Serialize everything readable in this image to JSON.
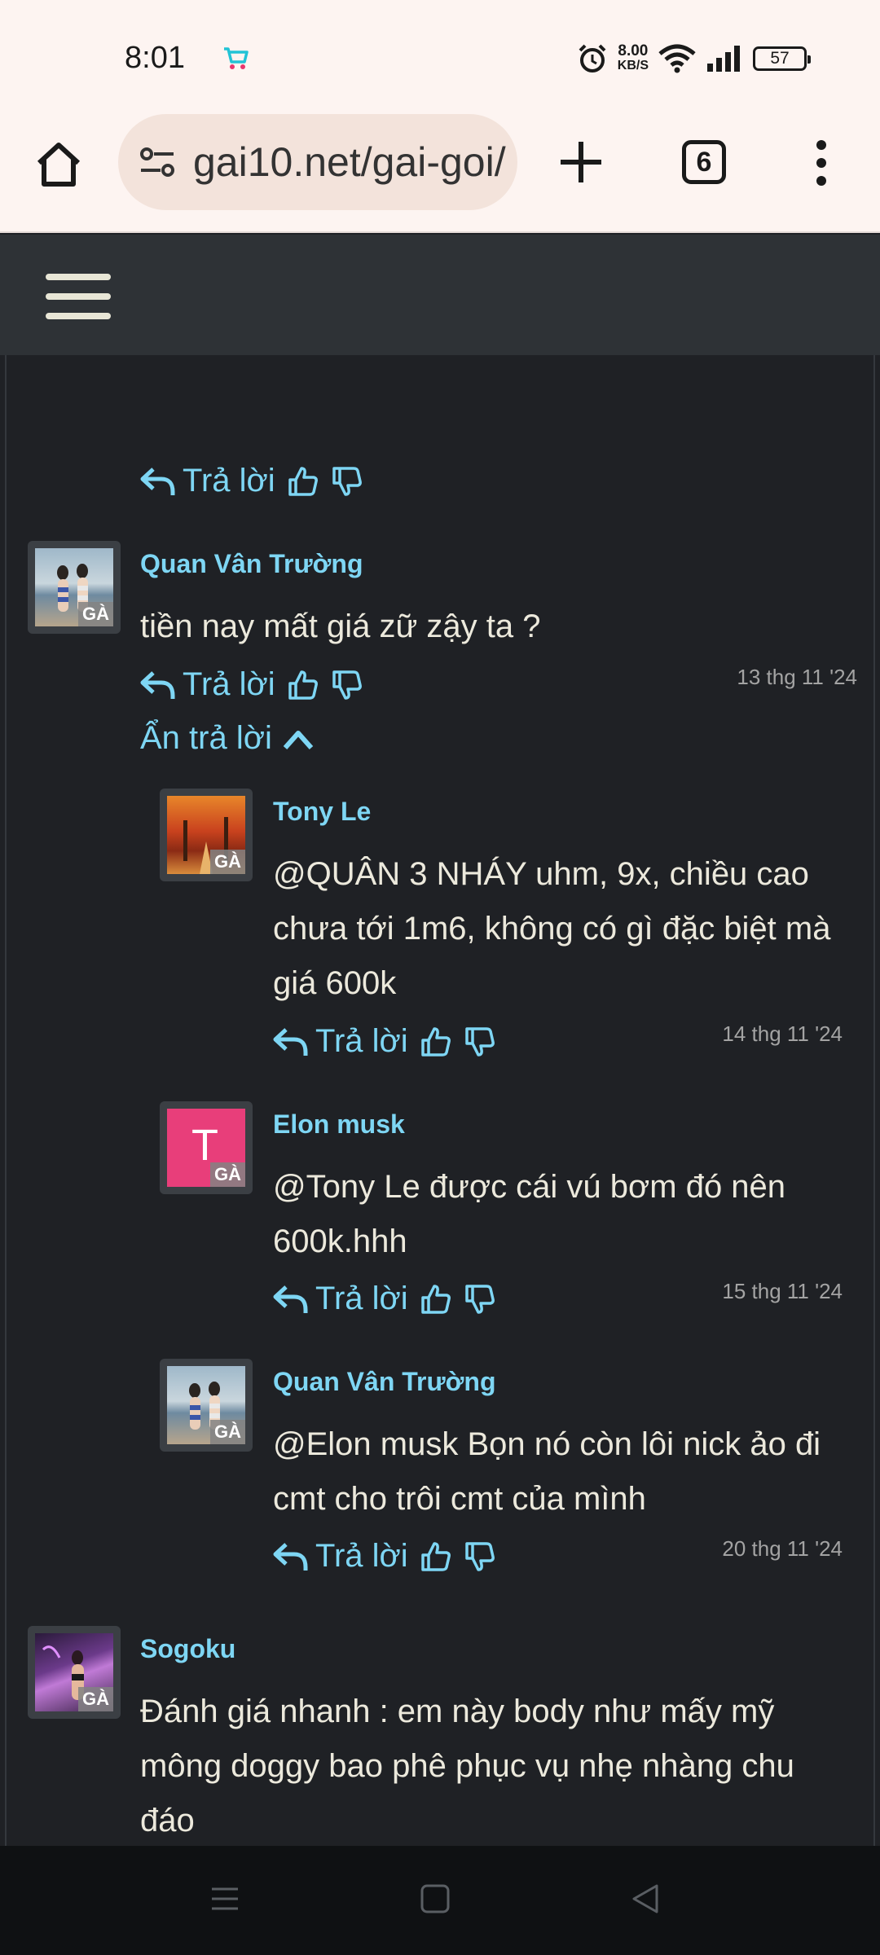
{
  "status_bar": {
    "time": "8:01",
    "net_speed_value": "8.00",
    "net_speed_unit": "KB/S",
    "battery": "57",
    "icons": [
      "shopping-app-icon",
      "alarm-icon",
      "wifi-icon",
      "signal-icon",
      "battery-icon"
    ]
  },
  "browser": {
    "url": "gai10.net/gai-goi/",
    "tab_count": "6"
  },
  "comments": {
    "top_reply_label": "Trả lời",
    "c1": {
      "author": "Quan Vân Trường",
      "text": "tiền nay mất giá zữ zậy ta ?",
      "date": "13 thg 11 '24",
      "reply_label": "Trả lời",
      "badge": "GÀ",
      "hide_replies_label": "Ẩn trả lời"
    },
    "r1": {
      "author": "Tony Le",
      "text": "@QUÂN 3 NHÁY uhm, 9x, chiều cao chưa tới 1m6, không có gì đặc biệt mà giá 600k",
      "date": "14 thg 11 '24",
      "reply_label": "Trả lời",
      "badge": "GÀ"
    },
    "r2": {
      "author": "Elon musk",
      "text": "@Tony Le được cái vú bơm đó nên 600k.hhh",
      "date": "15 thg 11 '24",
      "reply_label": "Trả lời",
      "badge": "GÀ",
      "avatar_letter": "T",
      "avatar_color": "#e83e7a"
    },
    "r3": {
      "author": "Quan Vân Trường",
      "text": "@Elon musk Bọn nó còn lôi nick ảo đi cmt cho trôi cmt của mình",
      "date": "20 thg 11 '24",
      "reply_label": "Trả lời",
      "badge": "GÀ"
    },
    "c2": {
      "author": "Sogoku",
      "text": "Đánh giá nhanh : em này body như mấy mỹ mông doggy bao phê phục vụ nhẹ nhàng chu đáo",
      "badge": "GÀ"
    }
  },
  "colors": {
    "accent": "#7ed6f4",
    "text": "#ece9dc",
    "background": "#1f2125",
    "header": "#2e3236"
  }
}
